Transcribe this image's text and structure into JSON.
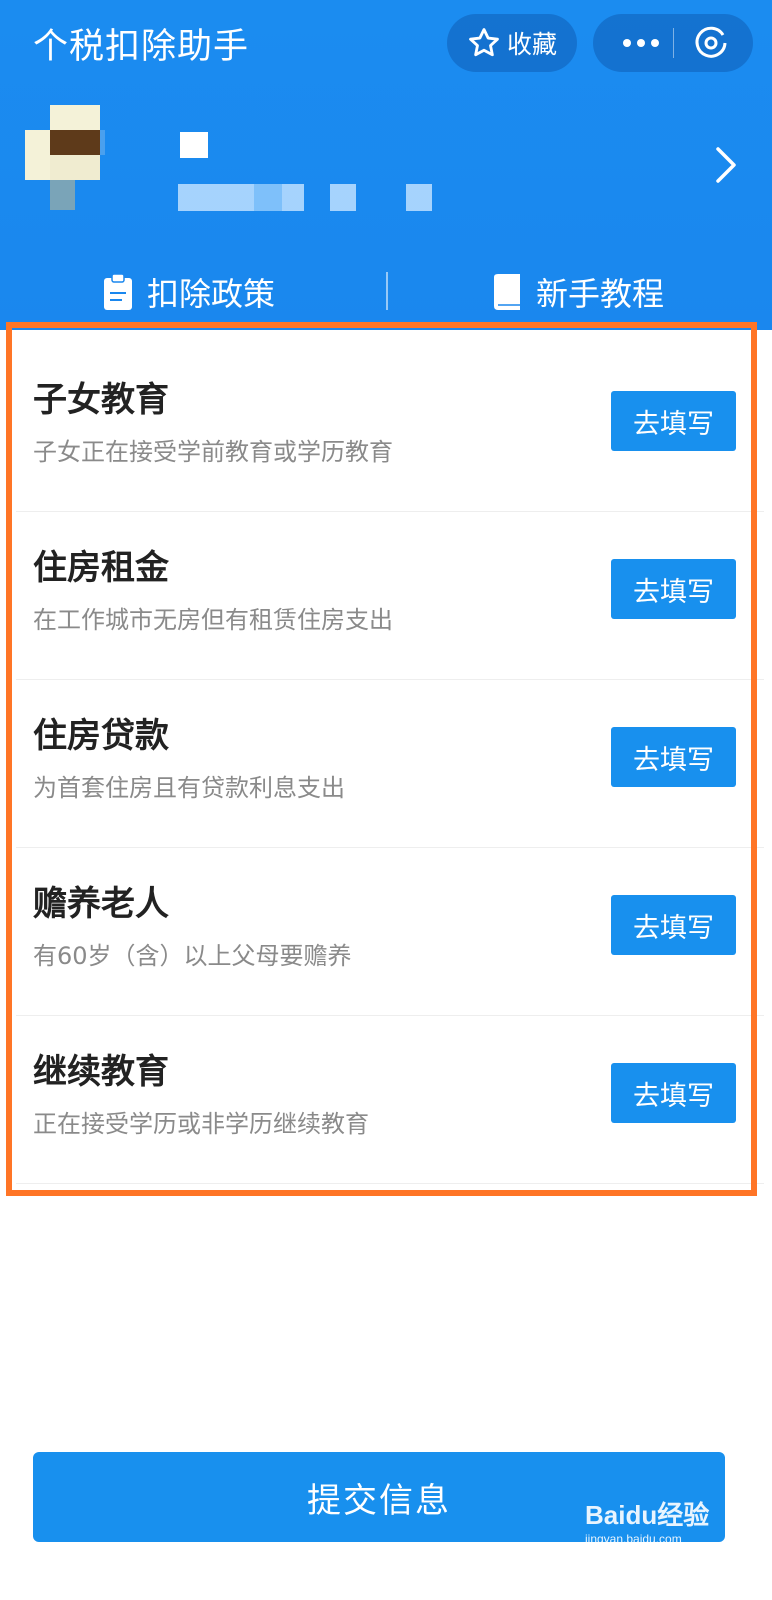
{
  "header": {
    "title": "个税扣除助手",
    "favorite_label": "收藏",
    "quick_links": [
      {
        "label": "扣除政策",
        "icon": "clipboard-icon"
      },
      {
        "label": "新手教程",
        "icon": "book-icon"
      }
    ]
  },
  "deductions": [
    {
      "title": "子女教育",
      "desc": "子女正在接受学前教育或学历教育",
      "button": "去填写"
    },
    {
      "title": "住房租金",
      "desc": "在工作城市无房但有租赁住房支出",
      "button": "去填写"
    },
    {
      "title": "住房贷款",
      "desc": "为首套住房且有贷款利息支出",
      "button": "去填写"
    },
    {
      "title": "赡养老人",
      "desc": "有60岁（含）以上父母要赡养",
      "button": "去填写"
    },
    {
      "title": "继续教育",
      "desc": "正在接受学历或非学历继续教育",
      "button": "去填写"
    }
  ],
  "footer": {
    "submit_label": "提交信息"
  },
  "watermark": {
    "brand": "Baidu经验",
    "url": "jingyan.baidu.com"
  },
  "colors": {
    "primary": "#1890ee",
    "highlight": "#ff7526"
  }
}
